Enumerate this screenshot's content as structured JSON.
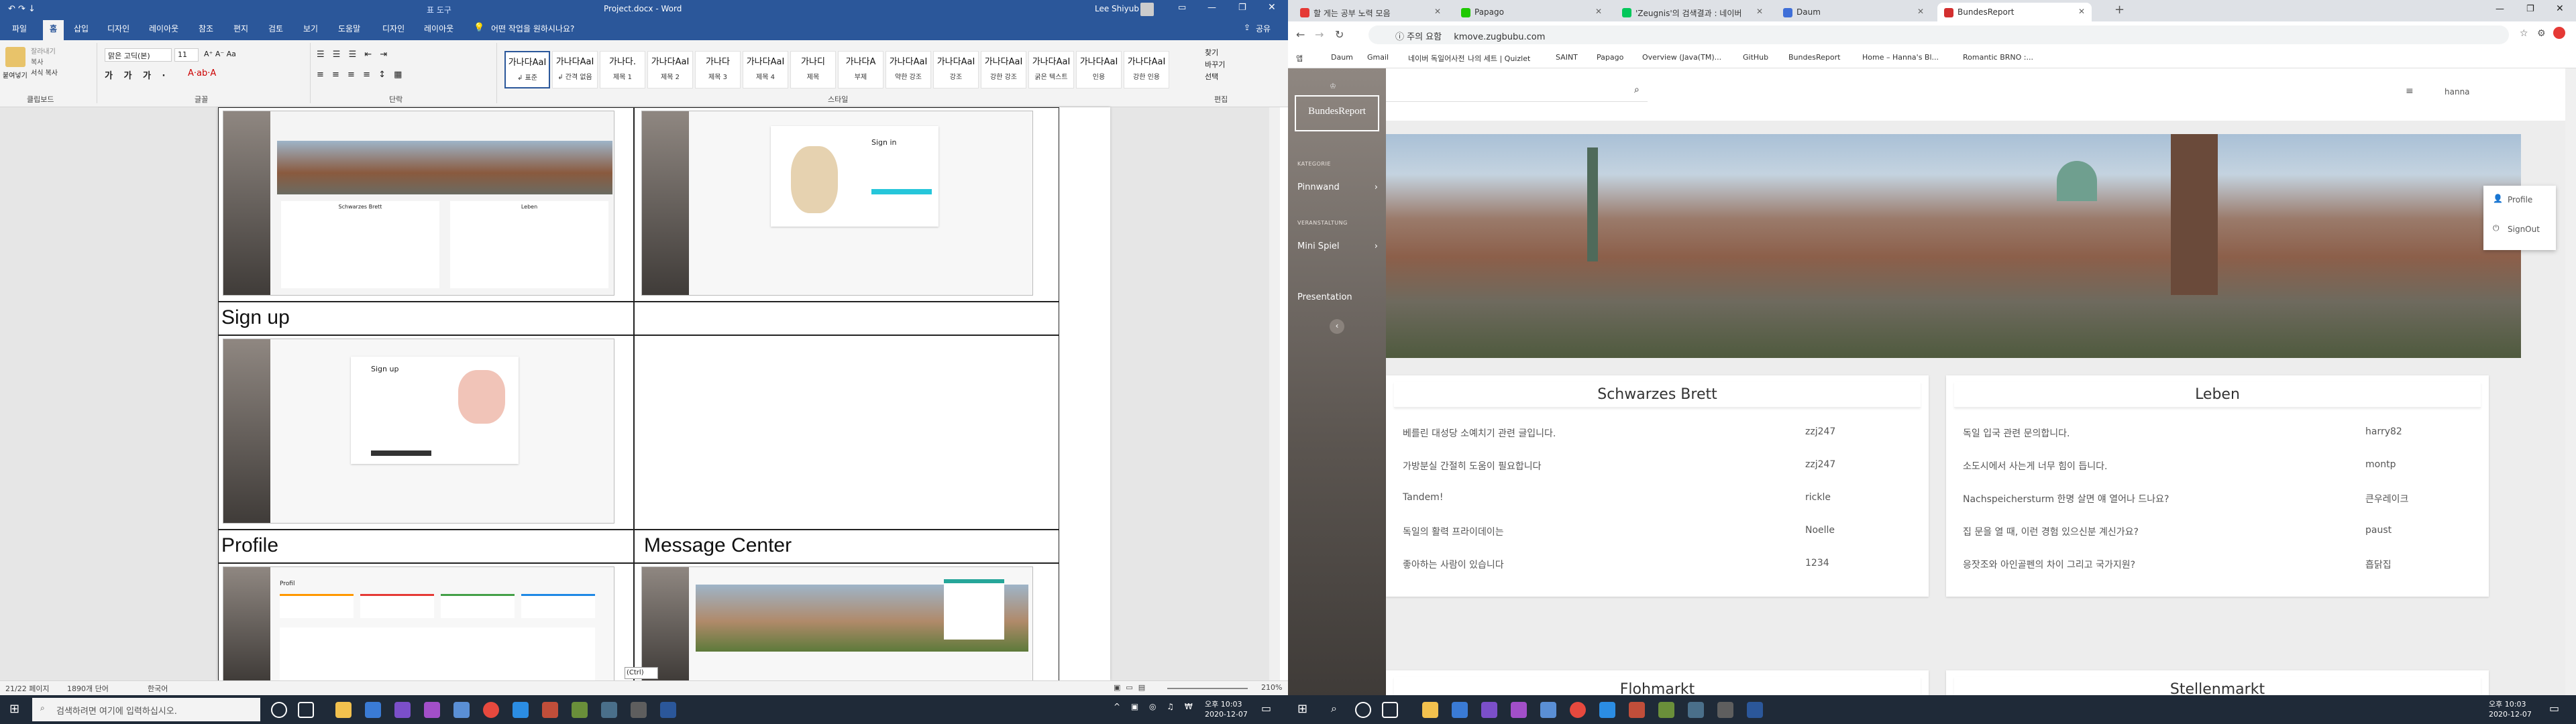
{
  "word": {
    "quick_access": "↶ ↷ ↓",
    "table_tools": "표 도구",
    "title": "Project.docx  -  Word",
    "user": "Lee Shiyub",
    "tabs": [
      "파일",
      "홈",
      "삽입",
      "디자인",
      "레이아웃",
      "참조",
      "편지",
      "검토",
      "보기",
      "도움말",
      "디자인",
      "레이아웃"
    ],
    "active_tab": "홈",
    "tell_me": "어떤 작업을 원하시나요?",
    "share": "공유",
    "clipboard": {
      "paste": "붙여넣기",
      "cut": "잘라내기",
      "copy": "복사",
      "format": "서식 복사",
      "group": "클립보드"
    },
    "font": {
      "name": "맑은 고딕(본)",
      "size": "11",
      "group": "글꼴"
    },
    "paragraph_group": "단락",
    "styles_group": "스타일",
    "styles": [
      {
        "preview": "가나다AaI",
        "name": "↲ 표준"
      },
      {
        "preview": "가나다AaI",
        "name": "↲ 간격 없음"
      },
      {
        "preview": "가나다.",
        "name": "제목 1"
      },
      {
        "preview": "가나다AaI",
        "name": "제목 2"
      },
      {
        "preview": "가나다",
        "name": "제목 3"
      },
      {
        "preview": "가나다AaI",
        "name": "제목 4"
      },
      {
        "preview": "가나디",
        "name": "제목"
      },
      {
        "preview": "가나다A",
        "name": "부제"
      },
      {
        "preview": "가나다AaI",
        "name": "약한 강조"
      },
      {
        "preview": "가나다AaI",
        "name": "강조"
      },
      {
        "preview": "가나다AaI",
        "name": "강한 강조"
      },
      {
        "preview": "가나다AaI",
        "name": "굵은 텍스트"
      },
      {
        "preview": "가나다AaI",
        "name": "인용"
      },
      {
        "preview": "가나다AaI",
        "name": "강한 인용"
      }
    ],
    "editing": {
      "find": "찾기",
      "replace": "바꾸기",
      "select": "선택",
      "group": "편집"
    },
    "doc": {
      "headings": {
        "signup": "Sign up",
        "profile": "Profile",
        "message": "Message Center"
      },
      "mini": {
        "signin": "Sign in",
        "signup": "Sign up",
        "profile": "Profil",
        "table1": "Schwarzes Brett",
        "table2": "Leben",
        "paste": "(Ctrl)"
      }
    },
    "status": {
      "page": "21/22 페이지",
      "words": "1890개 단어",
      "lang": "한국어",
      "zoom": "210%"
    },
    "taskbar": {
      "search": "검색하려면 여기에 입력하십시오.",
      "time": "오후 10:03",
      "date": "2020-12-07"
    }
  },
  "chrome": {
    "tabs": [
      {
        "title": "할 게는 공부 노력 모음",
        "color": "#e53935",
        "active": false
      },
      {
        "title": "Papago",
        "color": "#1ec800",
        "active": false
      },
      {
        "title": "'Zeugnis'의 검색결과 : 네이버",
        "color": "#03c75a",
        "active": false
      },
      {
        "title": "Daum",
        "color": "#3f6fd8",
        "active": false
      },
      {
        "title": "BundesReport",
        "color": "#d32f2f",
        "active": true
      }
    ],
    "new_tab": "+",
    "security": "ⓘ 주의 요함",
    "url": "kmove.zugbubu.com",
    "bookmarks": [
      "앱",
      "Daum",
      "Gmail",
      "네이버 독일어사전",
      "나의 세트 | Quizlet",
      "SAINT",
      "Papago",
      "Overview (Java(TM)...",
      "GitHub",
      "BundesReport",
      "Home – Hanna's Bl...",
      "Romantic BRNO :..."
    ],
    "site": {
      "logo": "BundesReport",
      "user": "hanna",
      "menu": [
        "Profile",
        "SignOut"
      ],
      "nav": [
        {
          "cat": "KATEGORIE",
          "label": "Pinnwand"
        },
        {
          "cat": "VERANSTALTUNG",
          "label": "Mini Spiel"
        }
      ],
      "presentation": "Presentation",
      "boards": [
        {
          "title": "Schwarzes Brett",
          "rows": [
            [
              "베를린 대성당 소예치기 관련 글입니다.",
              "zzj247"
            ],
            [
              "가방분실 간절히 도움이 필요합니다",
              "zzj247"
            ],
            [
              "Tandem!",
              "rickle"
            ],
            [
              "독일의 활력 프라이데이는",
              "Noelle"
            ],
            [
              "좋아하는 사람이 있습니다",
              "1234"
            ]
          ]
        },
        {
          "title": "Leben",
          "rows": [
            [
              "독일 입국 관련 문의합니다.",
              "harry82"
            ],
            [
              "소도시에서 사는게 너무 힘이 듭니다.",
              "montp"
            ],
            [
              "Nachspeichersturm 한명 살면 얘 열어나 드나요?",
              "큰우레이크"
            ],
            [
              "집 문을 열 때, 이런 경험 있으신분 계신가요?",
              "paust"
            ],
            [
              "응잣조와 아인골펜의 차이 그리고 국가지원?",
              "흡닭집"
            ]
          ]
        },
        {
          "title": "Flohmarkt",
          "rows": []
        },
        {
          "title": "Stellenmarkt",
          "rows": []
        }
      ]
    },
    "taskbar": {
      "time": "오후 10:03",
      "date": "2020-12-07"
    }
  }
}
